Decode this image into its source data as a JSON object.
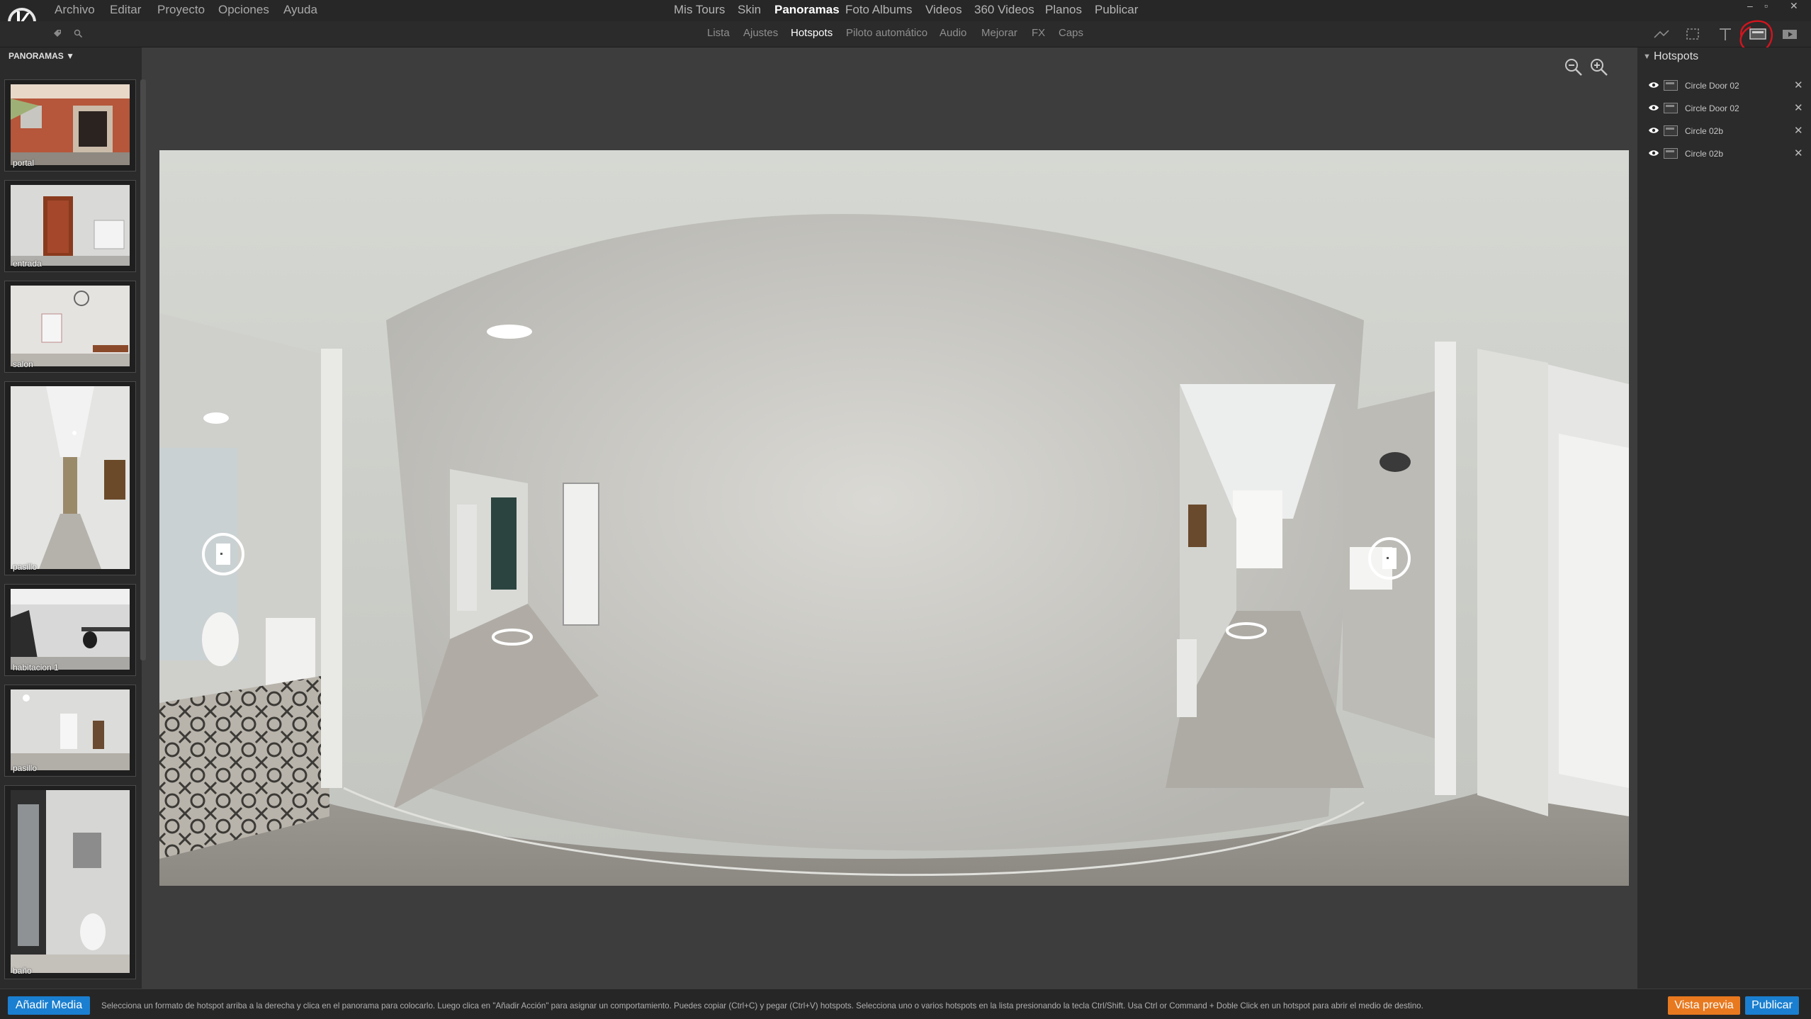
{
  "menu": [
    "Archivo",
    "Editar",
    "Proyecto",
    "Opciones",
    "Ayuda"
  ],
  "top_nav": {
    "items": [
      "Mis Tours",
      "Skin",
      "Panoramas",
      "Foto Albums",
      "Videos",
      "360 Videos",
      "Planos",
      "Publicar"
    ],
    "active": "Panoramas"
  },
  "window_controls": [
    "–",
    "▫",
    "✕"
  ],
  "sub_nav": {
    "items": [
      "Lista",
      "Ajustes",
      "Hotspots",
      "Piloto automático",
      "Audio",
      "Mejorar",
      "FX",
      "Caps"
    ],
    "active": "Hotspots"
  },
  "left_panel": {
    "header": "PANORAMAS ▼",
    "panoramas": [
      "portal",
      "entrada",
      "salon",
      "pasillo",
      "habitacion 1",
      "pasillo",
      "baño"
    ]
  },
  "right_panel": {
    "title": "Hotspots",
    "hotspots": [
      {
        "name": "Circle Door 02"
      },
      {
        "name": "Circle Door 02"
      },
      {
        "name": "Circle 02b"
      },
      {
        "name": "Circle 02b"
      }
    ]
  },
  "status": {
    "add_media": "Añadir Media",
    "hint": "Selecciona un formato de hotspot arriba a la derecha y clica en el panorama para colocarlo. Luego clica en \"Añadir Acción\" para asignar un comportamiento. Puedes copiar (Ctrl+C) y pegar (Ctrl+V) hotspots. Selecciona uno o varios hotspots en la lista presionando la tecla Ctrl/Shift. Usa Ctrl or Command + Doble Click en un hotspot para abrir el medio de destino.",
    "preview": "Vista previa",
    "publish": "Publicar"
  },
  "colors": {
    "accent_blue": "#1a7fd0",
    "preview_orange": "#e8791f",
    "highlight_red": "#d4141e"
  }
}
